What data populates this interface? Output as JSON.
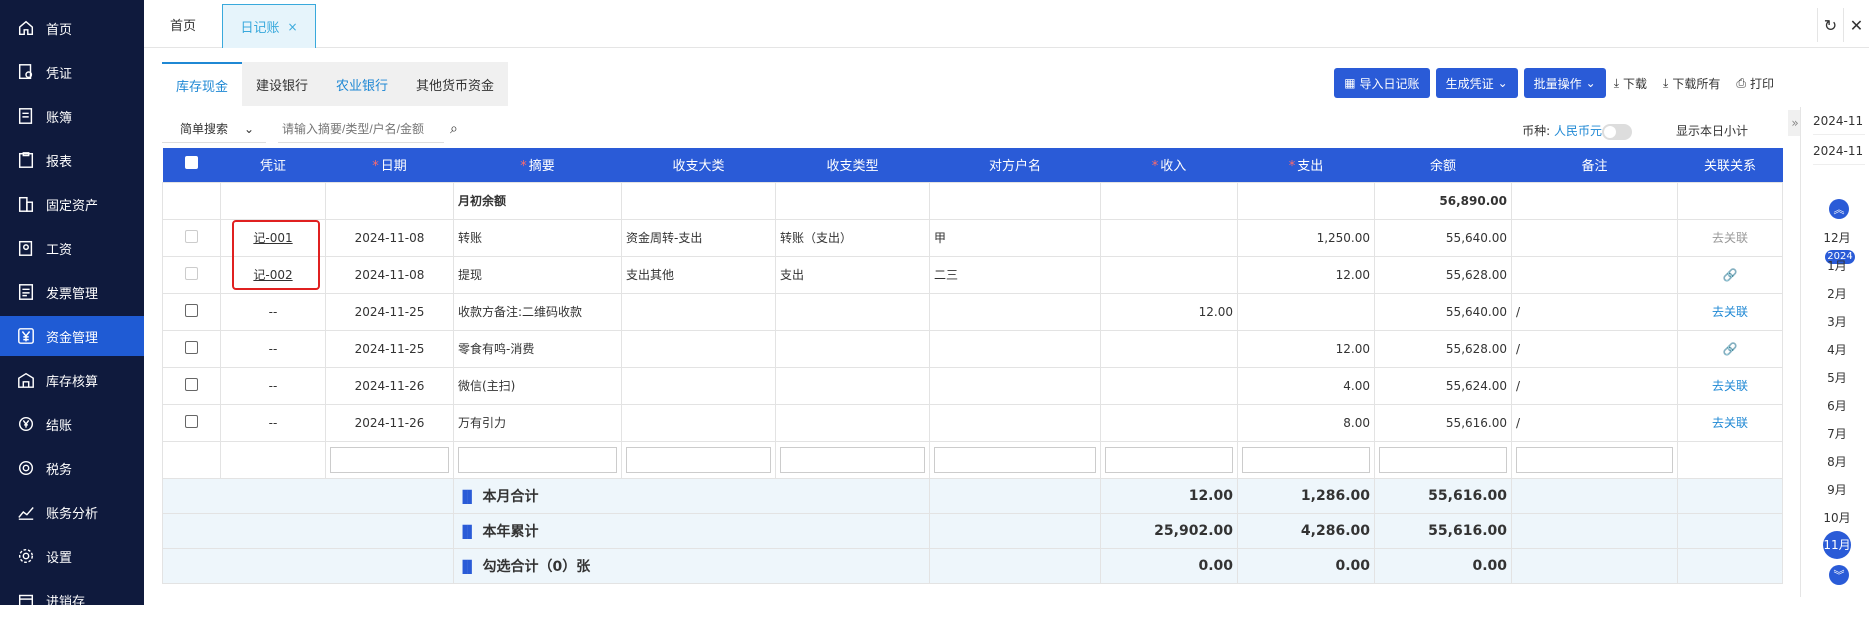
{
  "sidebar": {
    "items": [
      {
        "label": "首页",
        "icon": "home-icon"
      },
      {
        "label": "凭证",
        "icon": "voucher-icon"
      },
      {
        "label": "账簿",
        "icon": "ledger-icon"
      },
      {
        "label": "报表",
        "icon": "report-icon"
      },
      {
        "label": "固定资产",
        "icon": "building-icon"
      },
      {
        "label": "工资",
        "icon": "salary-icon"
      },
      {
        "label": "发票管理",
        "icon": "invoice-icon"
      },
      {
        "label": "资金管理",
        "icon": "yen-icon"
      },
      {
        "label": "库存核算",
        "icon": "warehouse-icon"
      },
      {
        "label": "结账",
        "icon": "settle-icon"
      },
      {
        "label": "税务",
        "icon": "tax-icon"
      },
      {
        "label": "账务分析",
        "icon": "trend-icon"
      },
      {
        "label": "设置",
        "icon": "gear-icon"
      },
      {
        "label": "进销存",
        "icon": "inventory-icon"
      }
    ],
    "active_index": 7
  },
  "topbar": {
    "home_tab": "首页",
    "journal_tab": "日记账",
    "close_glyph": "×",
    "refresh_glyph": "↻",
    "close_window_glyph": "✕"
  },
  "subtabs": [
    "库存现金",
    "建设银行",
    "农业银行",
    "其他货币资金"
  ],
  "actions": {
    "import": "导入日记账",
    "generate": "生成凭证",
    "batch": "批量操作",
    "download": "下载",
    "download_all": "下载所有",
    "print": "打印"
  },
  "search": {
    "mode": "简单搜索",
    "placeholder": "请输入摘要/类型/户名/金额",
    "currency_label": "币种:",
    "currency_value": "人民币元",
    "daily_subtotal": "显示本日小计"
  },
  "table": {
    "headers": [
      "凭证",
      "日期",
      "摘要",
      "收支大类",
      "收支类型",
      "对方户名",
      "收入",
      "支出",
      "余额",
      "备注",
      "关联关系"
    ],
    "opening": {
      "label": "月初余额",
      "balance": "56,890.00"
    },
    "rows": [
      {
        "voucher": "记-001",
        "date": "2024-11-08",
        "summary": "转账",
        "category": "资金周转-支出",
        "type": "转账（支出）",
        "party": "甲",
        "income": "",
        "expense": "1,250.00",
        "balance": "55,640.00",
        "note": "",
        "relation": "去关联"
      },
      {
        "voucher": "记-002",
        "date": "2024-11-08",
        "summary": "提现",
        "category": "支出其他",
        "type": "支出",
        "party": "二三",
        "income": "",
        "expense": "12.00",
        "balance": "55,628.00",
        "note": "",
        "relation": "link-icon"
      },
      {
        "voucher": "--",
        "date": "2024-11-25",
        "summary": "收款方备注:二维码收款",
        "category": "",
        "type": "",
        "party": "",
        "income": "12.00",
        "expense": "",
        "balance": "55,640.00",
        "note": "/",
        "relation": "去关联"
      },
      {
        "voucher": "--",
        "date": "2024-11-25",
        "summary": "零食有鸣-消费",
        "category": "",
        "type": "",
        "party": "",
        "income": "",
        "expense": "12.00",
        "balance": "55,628.00",
        "note": "/",
        "relation": "link-icon"
      },
      {
        "voucher": "--",
        "date": "2024-11-26",
        "summary": "微信(主扫)",
        "category": "",
        "type": "",
        "party": "",
        "income": "",
        "expense": "4.00",
        "balance": "55,624.00",
        "note": "/",
        "relation": "去关联"
      },
      {
        "voucher": "--",
        "date": "2024-11-26",
        "summary": "万有引力",
        "category": "",
        "type": "",
        "party": "",
        "income": "",
        "expense": "8.00",
        "balance": "55,616.00",
        "note": "/",
        "relation": "去关联"
      }
    ],
    "totals": [
      {
        "label": "本月合计",
        "income": "12.00",
        "expense": "1,286.00",
        "balance": "55,616.00"
      },
      {
        "label": "本年累计",
        "income": "25,902.00",
        "expense": "4,286.00",
        "balance": "55,616.00"
      },
      {
        "label": "勾选合计（0）张",
        "income": "0.00",
        "expense": "0.00",
        "balance": "0.00"
      }
    ]
  },
  "calendar": {
    "dates": [
      "2024-11",
      "2024-11"
    ],
    "year_badge": "2024",
    "months": [
      "12月",
      "1月",
      "2月",
      "3月",
      "4月",
      "5月",
      "6月",
      "7月",
      "8月",
      "9月",
      "10月",
      "11月"
    ],
    "active_month": "11月"
  },
  "colors": {
    "primary": "#2a5bd7",
    "sidebar_bg": "#0f1a3d",
    "link_blue": "#1f88d4",
    "highlight_red": "#e02020"
  }
}
